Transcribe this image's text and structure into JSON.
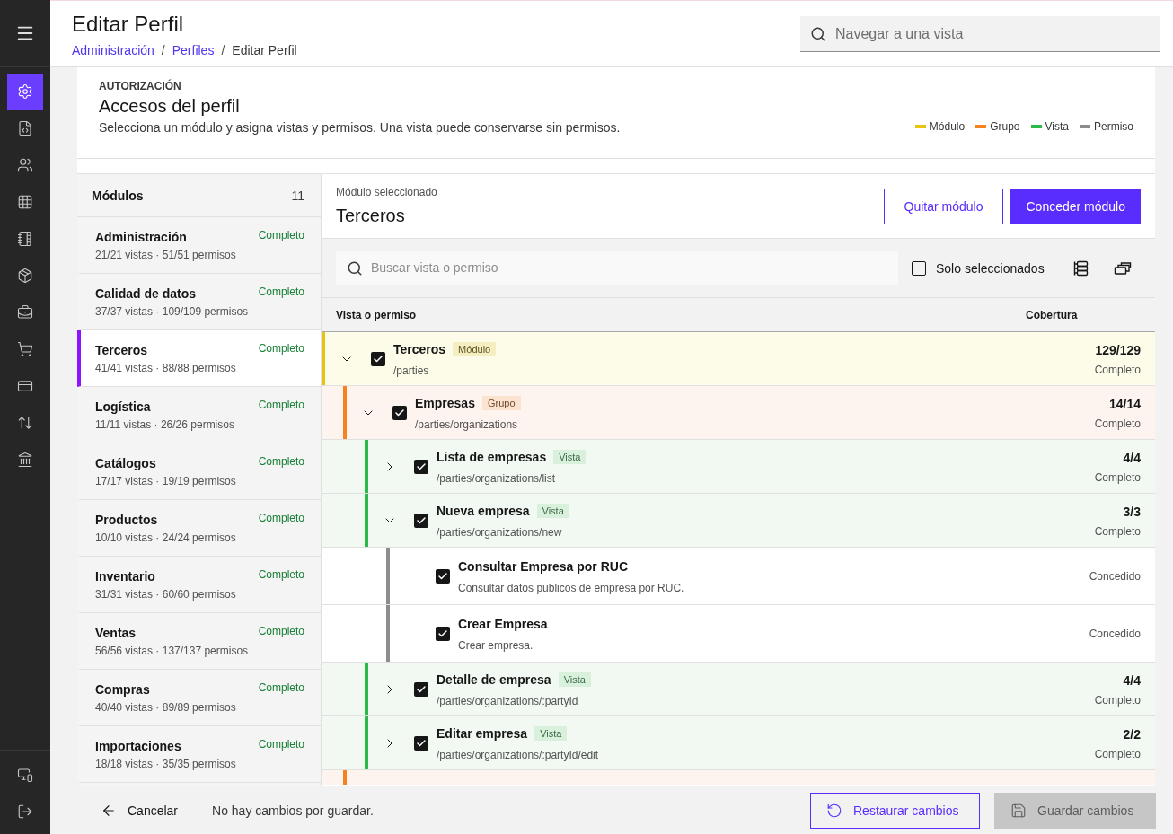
{
  "sidebar": {
    "nav": [
      {
        "selected": true
      },
      {
        "selected": false
      },
      {
        "selected": false
      },
      {
        "selected": false
      },
      {
        "selected": false
      },
      {
        "selected": false
      },
      {
        "selected": false
      },
      {
        "selected": false
      },
      {
        "selected": false
      },
      {
        "selected": false
      },
      {
        "selected": false
      }
    ]
  },
  "header": {
    "title": "Editar Perfil",
    "breadcrumb_separator": "/",
    "breadcrumbs": [
      {
        "label": "Administración",
        "current": false
      },
      {
        "label": "Perfiles",
        "current": false
      },
      {
        "label": "Editar Perfil",
        "current": true
      }
    ],
    "search": {
      "placeholder": "Navegar a una vista"
    }
  },
  "authorization": {
    "eyebrow": "AUTORIZACIÓN",
    "title": "Accesos del perfil",
    "description": "Selecciona un módulo y asigna vistas y permisos. Una vista puede conservarse sin permisos.",
    "legend": [
      {
        "label": "Módulo",
        "color": "#e8c40c"
      },
      {
        "label": "Grupo",
        "color": "#f5821f"
      },
      {
        "label": "Vista",
        "color": "#2eb84a"
      },
      {
        "label": "Permiso",
        "color": "#8d8d8d"
      }
    ]
  },
  "modules": {
    "title": "Módulos",
    "count": "11",
    "items": [
      {
        "name": "Administración",
        "status": "Completo",
        "summary": "21/21 vistas · 51/51 permisos",
        "selected": false
      },
      {
        "name": "Calidad de datos",
        "status": "Completo",
        "summary": "37/37 vistas · 109/109 permisos",
        "selected": false
      },
      {
        "name": "Terceros",
        "status": "Completo",
        "summary": "41/41 vistas · 88/88 permisos",
        "selected": true
      },
      {
        "name": "Logística",
        "status": "Completo",
        "summary": "11/11 vistas · 26/26 permisos",
        "selected": false
      },
      {
        "name": "Catálogos",
        "status": "Completo",
        "summary": "17/17 vistas · 19/19 permisos",
        "selected": false
      },
      {
        "name": "Productos",
        "status": "Completo",
        "summary": "10/10 vistas · 24/24 permisos",
        "selected": false
      },
      {
        "name": "Inventario",
        "status": "Completo",
        "summary": "31/31 vistas · 60/60 permisos",
        "selected": false
      },
      {
        "name": "Ventas",
        "status": "Completo",
        "summary": "56/56 vistas · 137/137 permisos",
        "selected": false
      },
      {
        "name": "Compras",
        "status": "Completo",
        "summary": "40/40 vistas · 89/89 permisos",
        "selected": false
      },
      {
        "name": "Importaciones",
        "status": "Completo",
        "summary": "18/18 vistas · 35/35 permisos",
        "selected": false
      }
    ]
  },
  "selected_module": {
    "label": "Módulo seleccionado",
    "name": "Terceros",
    "actions": [
      {
        "label": "Quitar módulo",
        "kind": "secondary"
      },
      {
        "label": "Conceder módulo",
        "kind": "primary"
      }
    ]
  },
  "toolbar": {
    "search": {
      "placeholder": "Buscar vista o permiso"
    },
    "only_selected": {
      "label": "Solo seleccionados",
      "checked": false
    }
  },
  "tree": {
    "columns": [
      "Vista o permiso",
      "Cobertura"
    ],
    "rows": [
      {
        "kind": "module",
        "title": "Terceros",
        "badge": "Módulo",
        "path": "/parties",
        "checked": true,
        "expanded": true,
        "count": "129/129",
        "status": "Completo",
        "children": [
          {
            "kind": "group",
            "title": "Empresas",
            "badge": "Grupo",
            "path": "/parties/organizations",
            "checked": true,
            "expanded": true,
            "count": "14/14",
            "status": "Completo",
            "children": [
              {
                "kind": "view",
                "title": "Lista de empresas",
                "badge": "Vista",
                "path": "/parties/organizations/list",
                "checked": true,
                "expanded": false,
                "count": "4/4",
                "status": "Completo"
              },
              {
                "kind": "view",
                "title": "Nueva empresa",
                "badge": "Vista",
                "path": "/parties/organizations/new",
                "checked": true,
                "expanded": true,
                "count": "3/3",
                "status": "Completo",
                "children": [
                  {
                    "kind": "permission",
                    "title": "Consultar Empresa por RUC",
                    "description": "Consultar datos publicos de empresa por RUC.",
                    "checked": true,
                    "status": "Concedido"
                  },
                  {
                    "kind": "permission",
                    "title": "Crear Empresa",
                    "description": "Crear empresa.",
                    "checked": true,
                    "status": "Concedido"
                  }
                ]
              },
              {
                "kind": "view",
                "title": "Detalle de empresa",
                "badge": "Vista",
                "path": "/parties/organizations/:partyId",
                "checked": true,
                "expanded": false,
                "count": "4/4",
                "status": "Completo"
              },
              {
                "kind": "view",
                "title": "Editar empresa",
                "badge": "Vista",
                "path": "/parties/organizations/:partyId/edit",
                "checked": true,
                "expanded": false,
                "count": "2/2",
                "status": "Completo"
              }
            ]
          },
          {
            "kind": "group"
          }
        ]
      }
    ]
  },
  "footer": {
    "cancel": "Cancelar",
    "message": "No hay cambios por guardar.",
    "actions": [
      {
        "label": "Restaurar cambios",
        "kind": "secondary",
        "disabled": false
      },
      {
        "label": "Guardar cambios",
        "kind": "primary",
        "disabled": true
      }
    ]
  }
}
